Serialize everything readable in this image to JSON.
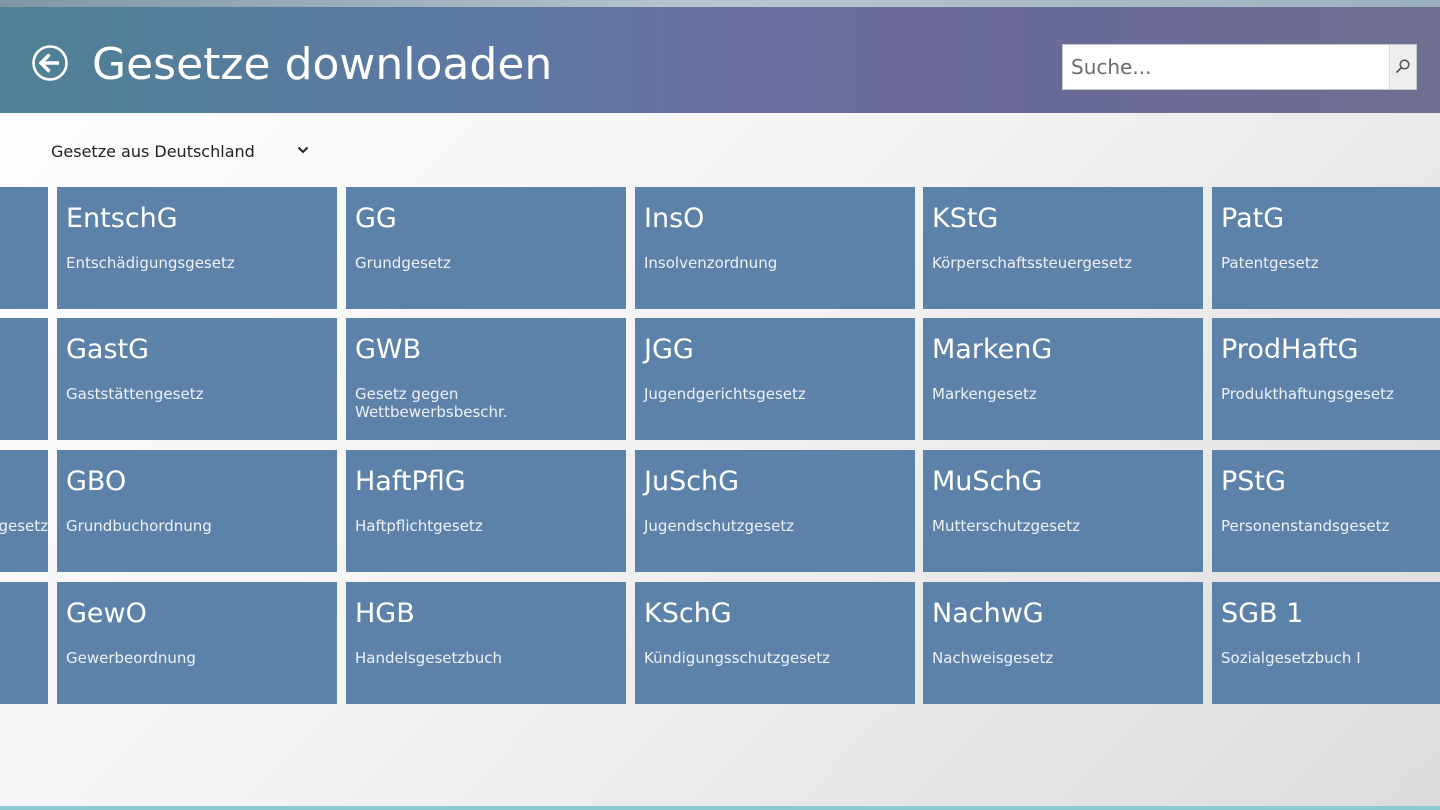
{
  "header": {
    "title": "Gesetze downloaden",
    "back_icon": "back-arrow-circle-icon"
  },
  "search": {
    "placeholder": "Suche...",
    "icon": "search-icon"
  },
  "filter": {
    "selected": "Gesetze aus Deutschland",
    "icon": "chevron-down-icon"
  },
  "partial_tiles": [
    {
      "name": ""
    },
    {
      "name": ""
    },
    {
      "name": "gesetz"
    },
    {
      "name": ""
    }
  ],
  "rows": [
    [
      {
        "abbr": "EntschG",
        "name": "Entschädigungsgesetz"
      },
      {
        "abbr": "GG",
        "name": "Grundgesetz"
      },
      {
        "abbr": "InsO",
        "name": "Insolvenzordnung"
      },
      {
        "abbr": "KStG",
        "name": "Körperschaftssteuergesetz"
      },
      {
        "abbr": "PatG",
        "name": "Patentgesetz"
      }
    ],
    [
      {
        "abbr": "GastG",
        "name": "Gaststättengesetz"
      },
      {
        "abbr": "GWB",
        "name": "Gesetz gegen Wettbewerbsbeschr."
      },
      {
        "abbr": "JGG",
        "name": "Jugendgerichtsgesetz"
      },
      {
        "abbr": "MarkenG",
        "name": "Markengesetz"
      },
      {
        "abbr": "ProdHaftG",
        "name": "Produkthaftungsgesetz"
      }
    ],
    [
      {
        "abbr": "GBO",
        "name": "Grundbuchordnung"
      },
      {
        "abbr": "HaftPflG",
        "name": "Haftpflichtgesetz"
      },
      {
        "abbr": "JuSchG",
        "name": "Jugendschutzgesetz"
      },
      {
        "abbr": "MuSchG",
        "name": "Mutterschutzgesetz"
      },
      {
        "abbr": "PStG",
        "name": "Personenstandsgesetz"
      }
    ],
    [
      {
        "abbr": "GewO",
        "name": "Gewerbeordnung"
      },
      {
        "abbr": "HGB",
        "name": "Handelsgesetzbuch"
      },
      {
        "abbr": "KSchG",
        "name": "Kündigungsschutzgesetz"
      },
      {
        "abbr": "NachwG",
        "name": "Nachweisgesetz"
      },
      {
        "abbr": "SGB 1",
        "name": "Sozialgesetzbuch I"
      }
    ]
  ]
}
